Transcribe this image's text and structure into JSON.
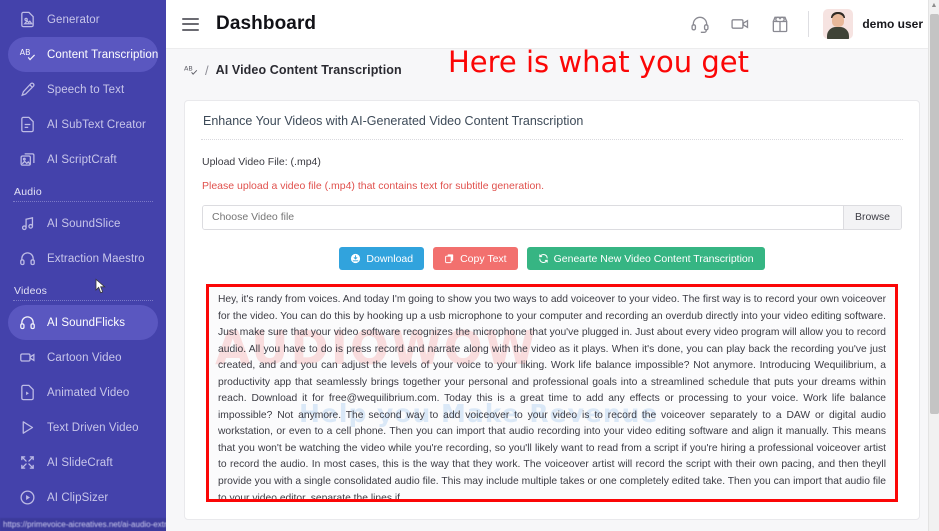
{
  "sidebar": {
    "items": [
      {
        "label": "Generator",
        "icon": "document-image-icon",
        "active": false
      },
      {
        "label": "Content Transcription",
        "icon": "ab-check-icon",
        "active": true
      },
      {
        "label": "Speech to Text",
        "icon": "microphone-icon",
        "active": false
      },
      {
        "label": "AI SubText Creator",
        "icon": "document-lines-icon",
        "active": false
      },
      {
        "label": "AI ScriptCraft",
        "icon": "image-stack-icon",
        "active": false
      }
    ],
    "section_audio": "Audio",
    "audio_items": [
      {
        "label": "AI SoundSlice",
        "icon": "music-note-icon",
        "active": false
      },
      {
        "label": "Extraction Maestro",
        "icon": "headphones-icon",
        "active": false
      }
    ],
    "section_videos": "Videos",
    "video_items": [
      {
        "label": "AI SoundFlicks",
        "icon": "headphones-icon",
        "active": true
      },
      {
        "label": "Cartoon Video",
        "icon": "video-camera-icon",
        "active": false
      },
      {
        "label": "Animated Video",
        "icon": "document-play-icon",
        "active": false
      },
      {
        "label": "Text Driven Video",
        "icon": "play-triangle-icon",
        "active": false
      },
      {
        "label": "AI SlideCraft",
        "icon": "expand-arrows-icon",
        "active": false
      },
      {
        "label": "AI ClipSizer",
        "icon": "play-circle-icon",
        "active": false
      }
    ],
    "status_url": "https://primevoice-aicreatives.net/ai-audio-extraction"
  },
  "topbar": {
    "title": "Dashboard",
    "icons": [
      "headset-icon",
      "video-camera-icon",
      "gift-shop-icon"
    ],
    "username": "demo user"
  },
  "breadcrumb": {
    "icon": "ab-check-icon",
    "separator": "/",
    "current": "AI Video Content Transcription"
  },
  "annotation": {
    "text": "Here is what you get",
    "color": "#fb0606"
  },
  "card": {
    "heading": "Enhance Your Videos with AI-Generated Video Content Transcription",
    "upload_label": "Upload Video File: (.mp4)",
    "warning": "Please upload a video file (.mp4) that contains text for subtitle generation.",
    "file_placeholder": "Choose Video file",
    "file_value": "",
    "browse_label": "Browse",
    "buttons": [
      {
        "label": "Download",
        "icon": "download-circle-icon",
        "color": "#31a3dd"
      },
      {
        "label": "Copy Text",
        "icon": "copy-icon",
        "color": "#f2706e"
      },
      {
        "label": "Genearte New Video Content Transcription",
        "icon": "refresh-icon",
        "color": "#36b583"
      }
    ]
  },
  "transcript": {
    "text": "Hey, it's randy from voices. And today I'm going to show you two ways to add voiceover to your video. The first way is to record your own voiceover for the video. You can do this by hooking up a usb microphone to your computer and recording an overdub directly into your video editing software. Just make sure that your video software recognizes the microphone that you've plugged in. Just about every video program will allow you to record audio. All you have to do is press record and narrate along with the video as it plays. When it's done, you can play back the recording you've just created, and and you can adjust the levels of your voice to your liking. Work life balance impossible? Not anymore. Introducing Wequilibrium, a productivity app that seamlessly brings together your personal and professional goals into a streamlined schedule that puts your dreams within reach. Download it for free@wequilibrium.com. Today this is a great time to add any effects or processing to your voice. Work life balance impossible? Not anymore. The second way to add voiceover to your video is to record the voiceover separately to a DAW or digital audio workstation, or even to a cell phone. Then you can import that audio recording into your video editing software and align it manually. This means that you won't be watching the video while you're recording, so you'll likely want to read from a script if you're hiring a professional voiceover artist to record the audio. In most cases, this is the way that they work. The voiceover artist will record the script with their own pacing, and then theyll provide you with a single consolidated audio file. This may include multiple takes or one completely edited take. Then you can import that audio file to your video editor, separate the lines if",
    "watermark_primary": "AUDIOWOW",
    "watermark_secondary": "Help you Make Revenue"
  }
}
